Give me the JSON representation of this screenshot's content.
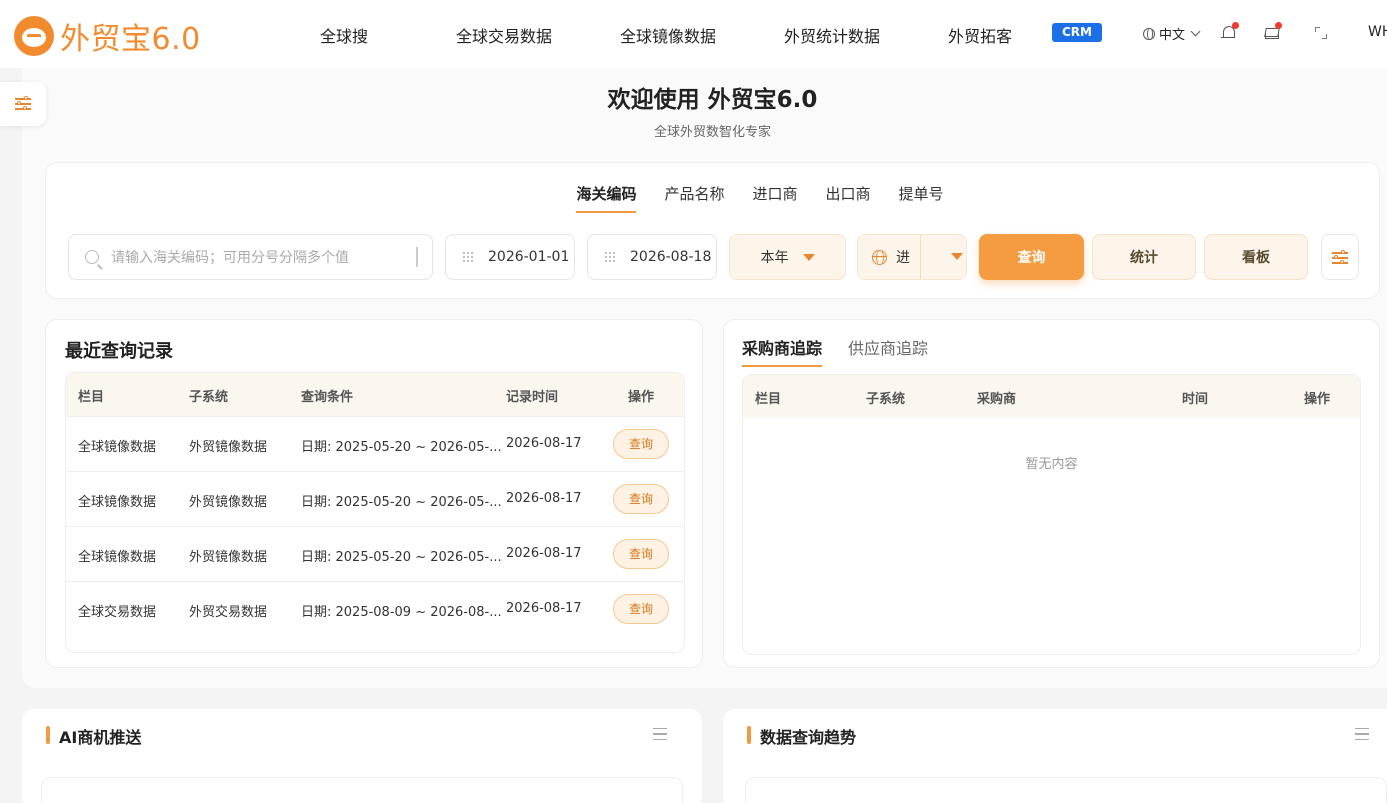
{
  "header": {
    "logo_text": "外贸宝6.0",
    "nav": [
      "全球搜",
      "全球交易数据",
      "全球镜像数据",
      "外贸统计数据",
      "外贸拓客"
    ],
    "crm": "CRM",
    "language": "中文",
    "user_truncated": "WH"
  },
  "welcome": {
    "title": "欢迎使用 外贸宝6.0",
    "subtitle": "全球外贸数智化专家"
  },
  "search": {
    "tabs": [
      "海关编码",
      "产品名称",
      "进口商",
      "出口商",
      "提单号"
    ],
    "active_tab": 0,
    "placeholder": "请输入海关编码；可用分号分隔多个值",
    "start_date": "2026-01-01",
    "end_date": "2026-08-18",
    "period": "本年",
    "direction": "进",
    "query_label": "查询",
    "stats_label": "统计",
    "board_label": "看板"
  },
  "recent": {
    "title": "最近查询记录",
    "columns": [
      "栏目",
      "子系统",
      "查询条件",
      "记录时间",
      "操作"
    ],
    "rows": [
      {
        "category": "全球镜像数据",
        "subsystem": "外贸镜像数据",
        "condition": "日期: 2025-05-20 ~ 2026-05-...",
        "time": "2026-08-17",
        "action": "查询"
      },
      {
        "category": "全球镜像数据",
        "subsystem": "外贸镜像数据",
        "condition": "日期: 2025-05-20 ~ 2026-05-...",
        "time": "2026-08-17",
        "action": "查询"
      },
      {
        "category": "全球镜像数据",
        "subsystem": "外贸镜像数据",
        "condition": "日期: 2025-05-20 ~ 2026-05-...",
        "time": "2026-08-17",
        "action": "查询"
      },
      {
        "category": "全球交易数据",
        "subsystem": "外贸交易数据",
        "condition": "日期: 2025-08-09 ~ 2026-08-...",
        "time": "2026-08-17",
        "action": "查询"
      }
    ]
  },
  "tracking": {
    "tabs": [
      "采购商追踪",
      "供应商追踪"
    ],
    "columns": [
      "栏目",
      "子系统",
      "采购商",
      "时间",
      "操作"
    ],
    "empty_text": "暂无内容"
  },
  "bottom": {
    "ai_title": "AI商机推送",
    "trend_title": "数据查询趋势"
  },
  "colors": {
    "accent": "#f29a3e",
    "primary_button": "#f49c3f",
    "crm_badge": "#1d6fe8",
    "notification_dot": "#f03b2e"
  },
  "icons": [
    "monkey-logo-icon",
    "globe-icon",
    "chevron-down-icon",
    "bell-icon",
    "layers-icon",
    "expand-icon",
    "filter-icon",
    "search-icon",
    "calendar-icon",
    "menu-icon"
  ]
}
